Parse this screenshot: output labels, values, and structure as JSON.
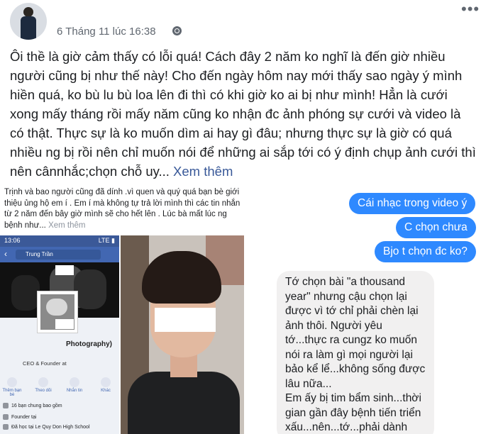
{
  "post": {
    "timestamp": "6 Tháng 11 lúc 16:38",
    "more_label": "•••",
    "text": "Ôi thề là giờ cảm thấy có lỗi quá! Cách đây 2 năm ko nghĩ là đến giờ nhiều người cũng bị như thế này! Cho đến ngày hôm nay mới thấy sao ngày ý mình hiền quá, ko bù lu bù loa lên đi thì có khi giờ ko ai bị như mình! Hẳn là cưới xong mấy tháng rồi mấy năm cũng ko nhận đc ảnh phóng sự cưới và video là có thật. Thực sự là ko muốn dìm ai hay gì đâu; nhưng thực sự là giờ có quá nhiều ng bị rồi nên chỉ muốn nói để những ai sắp tới có ý định chụp ảnh cưới thì nên cânnhắc;chọn chỗ uy...",
    "see_more": "Xem thêm"
  },
  "left_image": {
    "snippet": "Trịnh và bao người cũng đã dính .vì quen và quý quá bạn bè giới thiệu ủng hộ em í .  Em í mà không tự trả lời mình thì các tin nhắn từ 2 năm đến bây giờ mình sẽ cho hết lên . Lúc bà mất lúc ng bệnh như...",
    "snippet_more": "Xem thêm",
    "phone": {
      "time": "13:06",
      "status_right": "LTE ▮",
      "search_name": "Trung Trần",
      "cover_text": "Photography)",
      "role": "CEO & Founder at",
      "actions": [
        "Thêm bạn bè",
        "Theo dõi",
        "Nhắn tin",
        "Khác"
      ],
      "rows": [
        "16 bạn chung bao gồm",
        "Founder tại",
        "Đã học tại Le Quy Don High School"
      ]
    }
  },
  "chat": {
    "sent": [
      "Cái nhạc trong video ý",
      "C chọn chưa",
      "Bjo t chọn đc ko?"
    ],
    "received": "Tớ chọn bài \"a thousand year\" nhưng cậu chọn lại được vì tớ chỉ phải chèn lại ảnh thôi. Người yêu tớ...thực ra cungz ko muốn nói ra làm gì mọi người lại bảo kể lể...không sống được lâu nữa...\nEm ấy bị tim bẩm sinh...thời gian gần đây bệnh tiến triển xấu...nên...tớ...phải dành"
  }
}
